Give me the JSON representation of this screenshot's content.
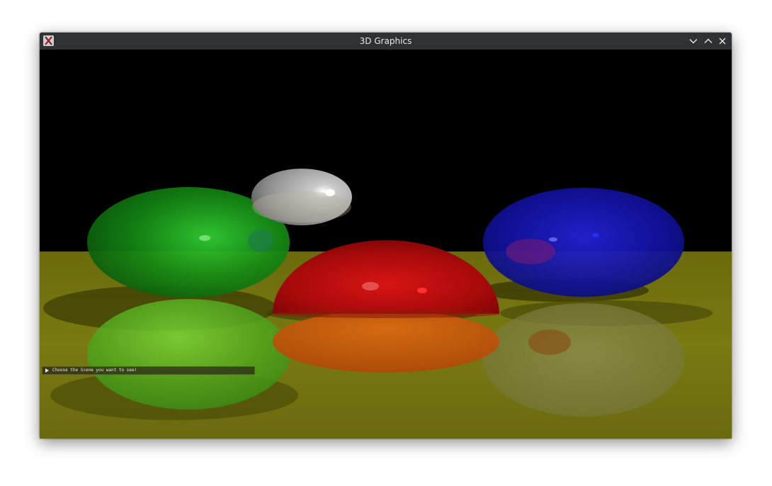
{
  "window": {
    "title": "3D Graphics",
    "icon": "x-window-icon",
    "controls": [
      "minimize",
      "maximize",
      "close"
    ]
  },
  "colors": {
    "titlebar": "#2f3235",
    "floor": "#7a7a10",
    "sky": "#000000",
    "sphere_green": "#1fa81f",
    "sphere_red": "#c20f0f",
    "sphere_blue": "#1515b0",
    "sphere_white": "#d8d8d8"
  },
  "scene_menu": {
    "label": "Choose the Scene you want to see!",
    "icon": "triangle-right-icon"
  }
}
